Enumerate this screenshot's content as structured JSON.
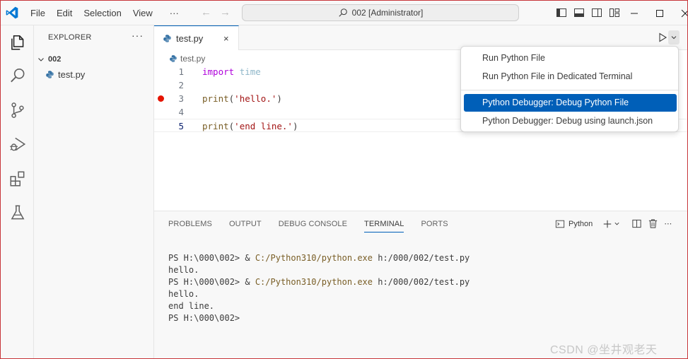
{
  "titlebar": {
    "menu": [
      "File",
      "Edit",
      "Selection",
      "View",
      "···"
    ],
    "search_text": "002 [Administrator]"
  },
  "sidebar": {
    "title": "EXPLORER",
    "more": "···",
    "folder": "002",
    "file": "test.py"
  },
  "editor": {
    "tab_label": "test.py",
    "tab_close": "×",
    "breadcrumb": "test.py",
    "lines": [
      {
        "num": "1",
        "parts": [
          {
            "cls": "kw",
            "text": "import"
          },
          {
            "cls": "plain",
            "text": " "
          },
          {
            "cls": "mod",
            "text": "time"
          }
        ]
      },
      {
        "num": "2",
        "parts": []
      },
      {
        "num": "3",
        "parts": [
          {
            "cls": "fn",
            "text": "print"
          },
          {
            "cls": "plain",
            "text": "("
          },
          {
            "cls": "str",
            "text": "'hello.'"
          },
          {
            "cls": "plain",
            "text": ")"
          }
        ],
        "breakpoint": true
      },
      {
        "num": "4",
        "parts": []
      },
      {
        "num": "5",
        "parts": [
          {
            "cls": "fn",
            "text": "print"
          },
          {
            "cls": "plain",
            "text": "("
          },
          {
            "cls": "str",
            "text": "'end line.'"
          },
          {
            "cls": "plain",
            "text": ")"
          }
        ],
        "current": true
      }
    ]
  },
  "run_menu": {
    "items": [
      "Run Python File",
      "Run Python File in Dedicated Terminal",
      "Python Debugger: Debug Python File",
      "Python Debugger: Debug using launch.json"
    ],
    "selected_index": 2
  },
  "panel": {
    "tabs": [
      "PROBLEMS",
      "OUTPUT",
      "DEBUG CONSOLE",
      "TERMINAL",
      "PORTS"
    ],
    "active_tab": 3,
    "terminal_profile": "Python",
    "terminal_lines": [
      {
        "prompt": "PS H:\\000\\002> & ",
        "exe": "C:/Python310/python.exe",
        "rest": " h:/000/002/test.py"
      },
      {
        "prompt": "hello.",
        "exe": "",
        "rest": ""
      },
      {
        "prompt": "PS H:\\000\\002> & ",
        "exe": "C:/Python310/python.exe",
        "rest": " h:/000/002/test.py"
      },
      {
        "prompt": "hello.",
        "exe": "",
        "rest": ""
      },
      {
        "prompt": "end line.",
        "exe": "",
        "rest": ""
      },
      {
        "prompt": "PS H:\\000\\002>",
        "exe": "",
        "rest": ""
      }
    ]
  },
  "watermark": "CSDN @坐井观老天",
  "colors": {
    "accent": "#005fb8",
    "breakpoint": "#e51400",
    "vscode_logo": "#0078d4"
  }
}
